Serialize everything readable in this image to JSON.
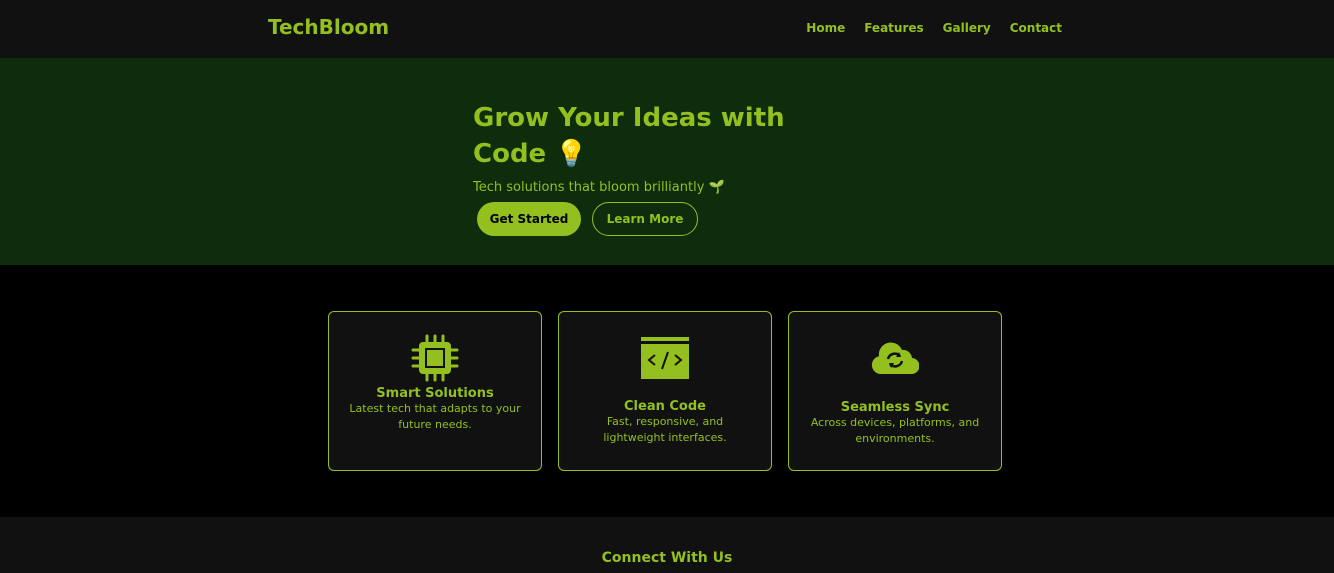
{
  "nav": {
    "logo": "TechBloom",
    "links": [
      "Home",
      "Features",
      "Gallery",
      "Contact"
    ]
  },
  "hero": {
    "title": "Grow Your Ideas with Code 💡",
    "subtitle": "Tech solutions that bloom brilliantly 🌱",
    "primary_button": "Get Started",
    "secondary_button": "Learn More"
  },
  "features": [
    {
      "icon": "chip-icon",
      "title": "Smart Solutions",
      "text": "Latest tech that adapts to your future needs."
    },
    {
      "icon": "code-window-icon",
      "title": "Clean Code",
      "text": "Fast, responsive, and lightweight interfaces."
    },
    {
      "icon": "cloud-sync-icon",
      "title": "Seamless Sync",
      "text": "Across devices, platforms, and environments."
    }
  ],
  "footer": {
    "heading": "Connect With Us"
  },
  "colors": {
    "accent": "#93c01f",
    "hero_bg": "#0d2d0c",
    "nav_bg": "#111111"
  }
}
